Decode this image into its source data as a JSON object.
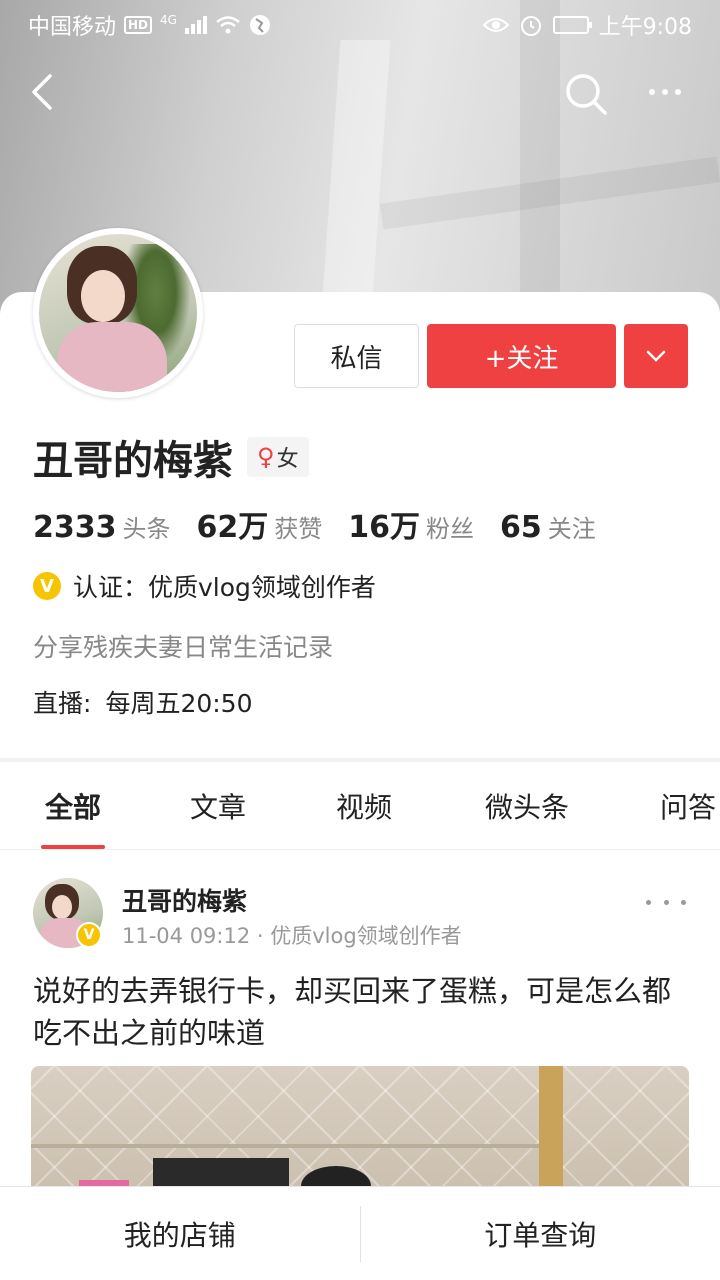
{
  "status_bar": {
    "carrier": "中国移动",
    "hd_badge": "HD",
    "network": "4G",
    "time": "上午9:08"
  },
  "profile": {
    "name": "丑哥的梅紫",
    "gender_label": "女",
    "gender_symbol": "♀",
    "message_button": "私信",
    "follow_button": "+关注",
    "stats": [
      {
        "value": "2333",
        "label": "头条"
      },
      {
        "value": "62万",
        "label": "获赞"
      },
      {
        "value": "16万",
        "label": "粉丝"
      },
      {
        "value": "65",
        "label": "关注"
      }
    ],
    "verify_badge": "V",
    "verification": "认证：优质vlog领域创作者",
    "bio": "分享残疾夫妻日常生活记录",
    "live_label": "直播:",
    "live_schedule": "每周五20:50"
  },
  "tabs": [
    {
      "label": "全部",
      "active": true
    },
    {
      "label": "文章",
      "active": false
    },
    {
      "label": "视频",
      "active": false
    },
    {
      "label": "微头条",
      "active": false
    },
    {
      "label": "问答",
      "active": false
    }
  ],
  "post": {
    "author": "丑哥的梅紫",
    "verify_badge": "V",
    "meta": "11-04 09:12 · 优质vlog领域创作者",
    "text": "说好的去弄银行卡，却买回来了蛋糕，可是怎么都吃不出之前的味道"
  },
  "bottom_bar": {
    "shop": "我的店铺",
    "orders": "订单查询"
  },
  "colors": {
    "accent": "#f04142",
    "verify": "#f6c500"
  }
}
